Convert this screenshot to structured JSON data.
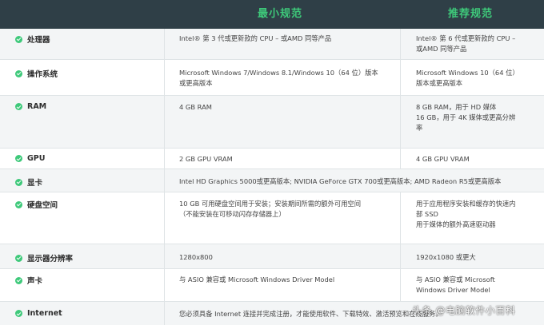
{
  "header": {
    "minimum": "最小规范",
    "recommended": "推荐规范"
  },
  "rows": [
    {
      "label": "处理器",
      "minimum": "Intel® 第 3 代或更新款的 CPU – 或AMD 同等产品",
      "recommended": "Intel® 第 6 代或更新款的 CPU –\n或AMD 同等产品"
    },
    {
      "label": "操作系统",
      "minimum": "Microsoft Windows 7/Windows 8.1/Windows 10（64 位）版本\n或更高版本",
      "recommended": "Microsoft Windows 10（64 位）\n版本或更高版本"
    },
    {
      "label": "RAM",
      "minimum": "4 GB RAM",
      "recommended": "8 GB RAM，用于 HD 媒体\n16 GB，用于 4K 媒体或更高分辨\n率"
    },
    {
      "label": "GPU",
      "minimum": "2 GB GPU VRAM",
      "recommended": "4 GB GPU VRAM"
    },
    {
      "label": "显卡",
      "span": "Intel HD Graphics 5000或更高版本; NVIDIA GeForce GTX 700或更高版本; AMD Radeon R5或更高版本"
    },
    {
      "label": "硬盘空间",
      "minimum": "10 GB 可用硬盘空间用于安装；安装期间所需的额外可用空间\n（不能安装在可移动闪存存储器上）",
      "recommended": "用于应用程序安装和缓存的快速内\n部 SSD\n用于媒体的额外高速驱动器"
    },
    {
      "label": "显示器分辨率",
      "minimum": "1280x800",
      "recommended": "1920x1080 或更大"
    },
    {
      "label": "声卡",
      "minimum": "与 ASIO 兼容或 Microsoft Windows Driver Model",
      "recommended": "与 ASIO 兼容或 Microsoft\nWindows Driver Model"
    },
    {
      "label": "Internet",
      "span": "您必须具备 Internet 连接并完成注册，才能使用软件、下载特效、激活预览和在线服务。"
    }
  ],
  "watermark": "头条 @电脑软件小百科",
  "colors": {
    "header_bg": "#2f3f47",
    "accent": "#3ec97a",
    "row_shade": "#f3f5f6"
  }
}
